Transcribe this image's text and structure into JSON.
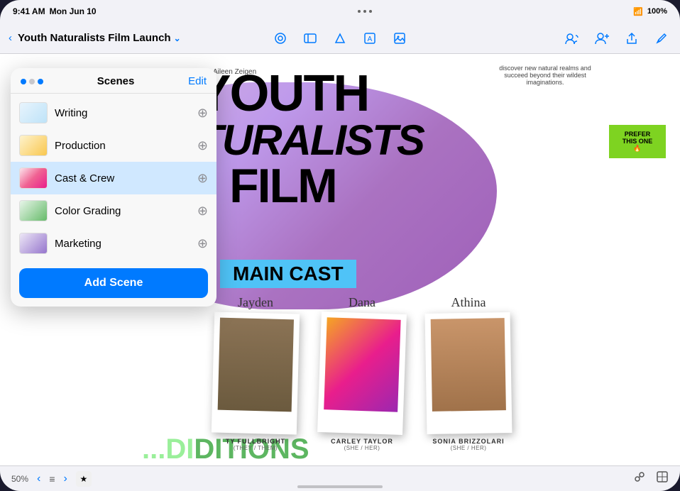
{
  "status_bar": {
    "time": "9:41 AM",
    "date": "Mon Jun 10",
    "wifi_icon": "wifi",
    "battery": "100%",
    "dots": [
      "•",
      "•",
      "•"
    ]
  },
  "toolbar": {
    "back_label": "‹",
    "title": "Youth Naturalists Film Launch",
    "title_chevron": "⌄",
    "center_icons": [
      "circle-icon",
      "square-icon",
      "shape-icon",
      "text-icon",
      "image-icon"
    ],
    "right_icons": [
      "person-wave-icon",
      "person-plus-icon",
      "share-icon",
      "pencil-icon"
    ]
  },
  "canvas": {
    "author": "Aileen Zeigen",
    "description": "discover new natural realms and succeed beyond their wildest imaginations.",
    "main_title_line1": "YOUTH",
    "main_title_line2": "NATURALISTS",
    "main_title_line3": "FILM",
    "main_cast_badge": "MAIN CAST",
    "cast": [
      {
        "script_name": "Jayden",
        "name": "TY FULLBRIGHT",
        "pronouns": "(THEY / THEM)"
      },
      {
        "script_name": "Dana",
        "name": "CARLEY TAYLOR",
        "pronouns": "(SHE / HER)"
      },
      {
        "script_name": "Athina",
        "name": "SONIA BRIZZOLARI",
        "pronouns": "(SHE / HER)"
      }
    ],
    "sticky_note": "PREFER\nTHIS ONE\n🔥",
    "auditions_text": "DITIONS"
  },
  "scenes_panel": {
    "title": "Scenes",
    "edit_label": "Edit",
    "items": [
      {
        "id": "writing",
        "label": "Writing",
        "active": false
      },
      {
        "id": "production",
        "label": "Production",
        "active": false
      },
      {
        "id": "cast-crew",
        "label": "Cast & Crew",
        "active": true
      },
      {
        "id": "color-grading",
        "label": "Color Grading",
        "active": false
      },
      {
        "id": "marketing",
        "label": "Marketing",
        "active": false
      }
    ],
    "add_scene_label": "Add Scene"
  },
  "bottom_bar": {
    "zoom": "50%",
    "back_icon": "‹",
    "forward_icon": "›",
    "list_icon": "≡",
    "star_icon": "★",
    "right_icons": [
      "link-icon",
      "square-icon"
    ]
  }
}
